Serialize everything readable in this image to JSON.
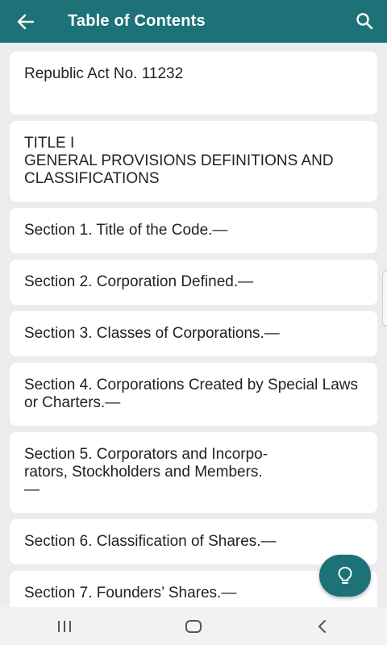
{
  "appbar": {
    "title": "Table of Contents",
    "back_icon": "arrow-left-icon",
    "search_icon": "search-icon",
    "color": "#1c7276"
  },
  "toc": {
    "items": [
      {
        "text": "Republic Act No. 11232",
        "min_height": 78
      },
      {
        "text": "TITLE I\nGENERAL PROVISIONS DEFINITIONS AND CLASSIFICATIONS",
        "min_height": 98
      },
      {
        "text": "Section 1. Title of the Code.—",
        "min_height": 54
      },
      {
        "text": "Section 2. Corporation Defined.—",
        "min_height": 54
      },
      {
        "text": "Section 3. Classes of Corporations.—",
        "min_height": 54
      },
      {
        "text": "Section 4. Corporations Created by Special Laws or Charters.—",
        "min_height": 76
      },
      {
        "text": "Section 5. Corporators and Incorpo-\nrators, Stockholders and Members.\n—",
        "min_height": 98
      },
      {
        "text": "Section 6. Classification of Shares.—",
        "min_height": 54
      },
      {
        "text": "Section 7. Founders’ Shares.—",
        "min_height": 54
      }
    ]
  },
  "fab": {
    "icon": "lightbulb-icon"
  },
  "navbar": {
    "recents_icon": "recents-icon",
    "home_icon": "home-icon",
    "back_icon": "nav-back-icon"
  }
}
